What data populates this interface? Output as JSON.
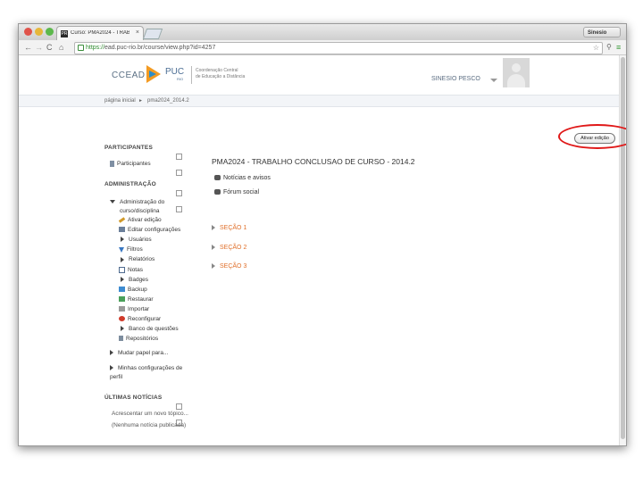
{
  "browser": {
    "tab_icon": "PR",
    "tab_title": "Curso: PMA2024 - TRABA",
    "tab_close": "×",
    "user_chip": "Sinesio",
    "https": "https://",
    "url": "ead.puc-rio.br/course/view.php?id=4257"
  },
  "header": {
    "logo_text": "CCEAD",
    "logo_puc": "PUC",
    "logo_sub": "RIO",
    "coord_line1": "Coordenação Central",
    "coord_line2": "de Educação a Distância",
    "user_name": "SINESIO PESCO"
  },
  "breadcrumb": {
    "home": "página inicial",
    "sep": "►",
    "course": "pma2024_2014.2"
  },
  "edit_button": "Ativar edição",
  "participants_block": {
    "title": "PARTICIPANTES",
    "item": "Participantes"
  },
  "admin_block": {
    "title": "ADMINISTRAÇÃO",
    "root_line1": "Administração do",
    "root_line2": "curso/disciplina",
    "items": [
      {
        "label": "Ativar edição",
        "icon": "pencil-icon"
      },
      {
        "label": "Editar configurações",
        "icon": "settings-icon"
      },
      {
        "label": "Usuários",
        "icon": "expand-icon"
      },
      {
        "label": "Filtros",
        "icon": "filter-icon"
      },
      {
        "label": "Relatórios",
        "icon": "expand-icon"
      },
      {
        "label": "Notas",
        "icon": "grades-icon"
      },
      {
        "label": "Badges",
        "icon": "expand-icon"
      },
      {
        "label": "Backup",
        "icon": "backup-icon"
      },
      {
        "label": "Restaurar",
        "icon": "restore-icon"
      },
      {
        "label": "Importar",
        "icon": "import-icon"
      },
      {
        "label": "Reconfigurar",
        "icon": "reset-icon"
      },
      {
        "label": "Banco de questões",
        "icon": "expand-icon"
      },
      {
        "label": "Repositórios",
        "icon": "repository-icon"
      }
    ],
    "switch_role": "Mudar papel para...",
    "profile_line1": "Minhas configurações de",
    "profile_line2": "perfil"
  },
  "news_block": {
    "title": "ÚLTIMAS NOTÍCIAS",
    "add_topic": "Acrescentar um novo tópico...",
    "none": "(Nenhuma notícia publicada)"
  },
  "main": {
    "course_title": "PMA2024 - TRABALHO CONCLUSAO DE CURSO - 2014.2",
    "links": [
      "Notícias e avisos",
      "Fórum social"
    ],
    "sections": [
      "SEÇÃO 1",
      "SEÇÃO 2",
      "SEÇÃO 3"
    ]
  },
  "colors": {
    "section": "#e0702b",
    "annotation": "#e01818"
  }
}
